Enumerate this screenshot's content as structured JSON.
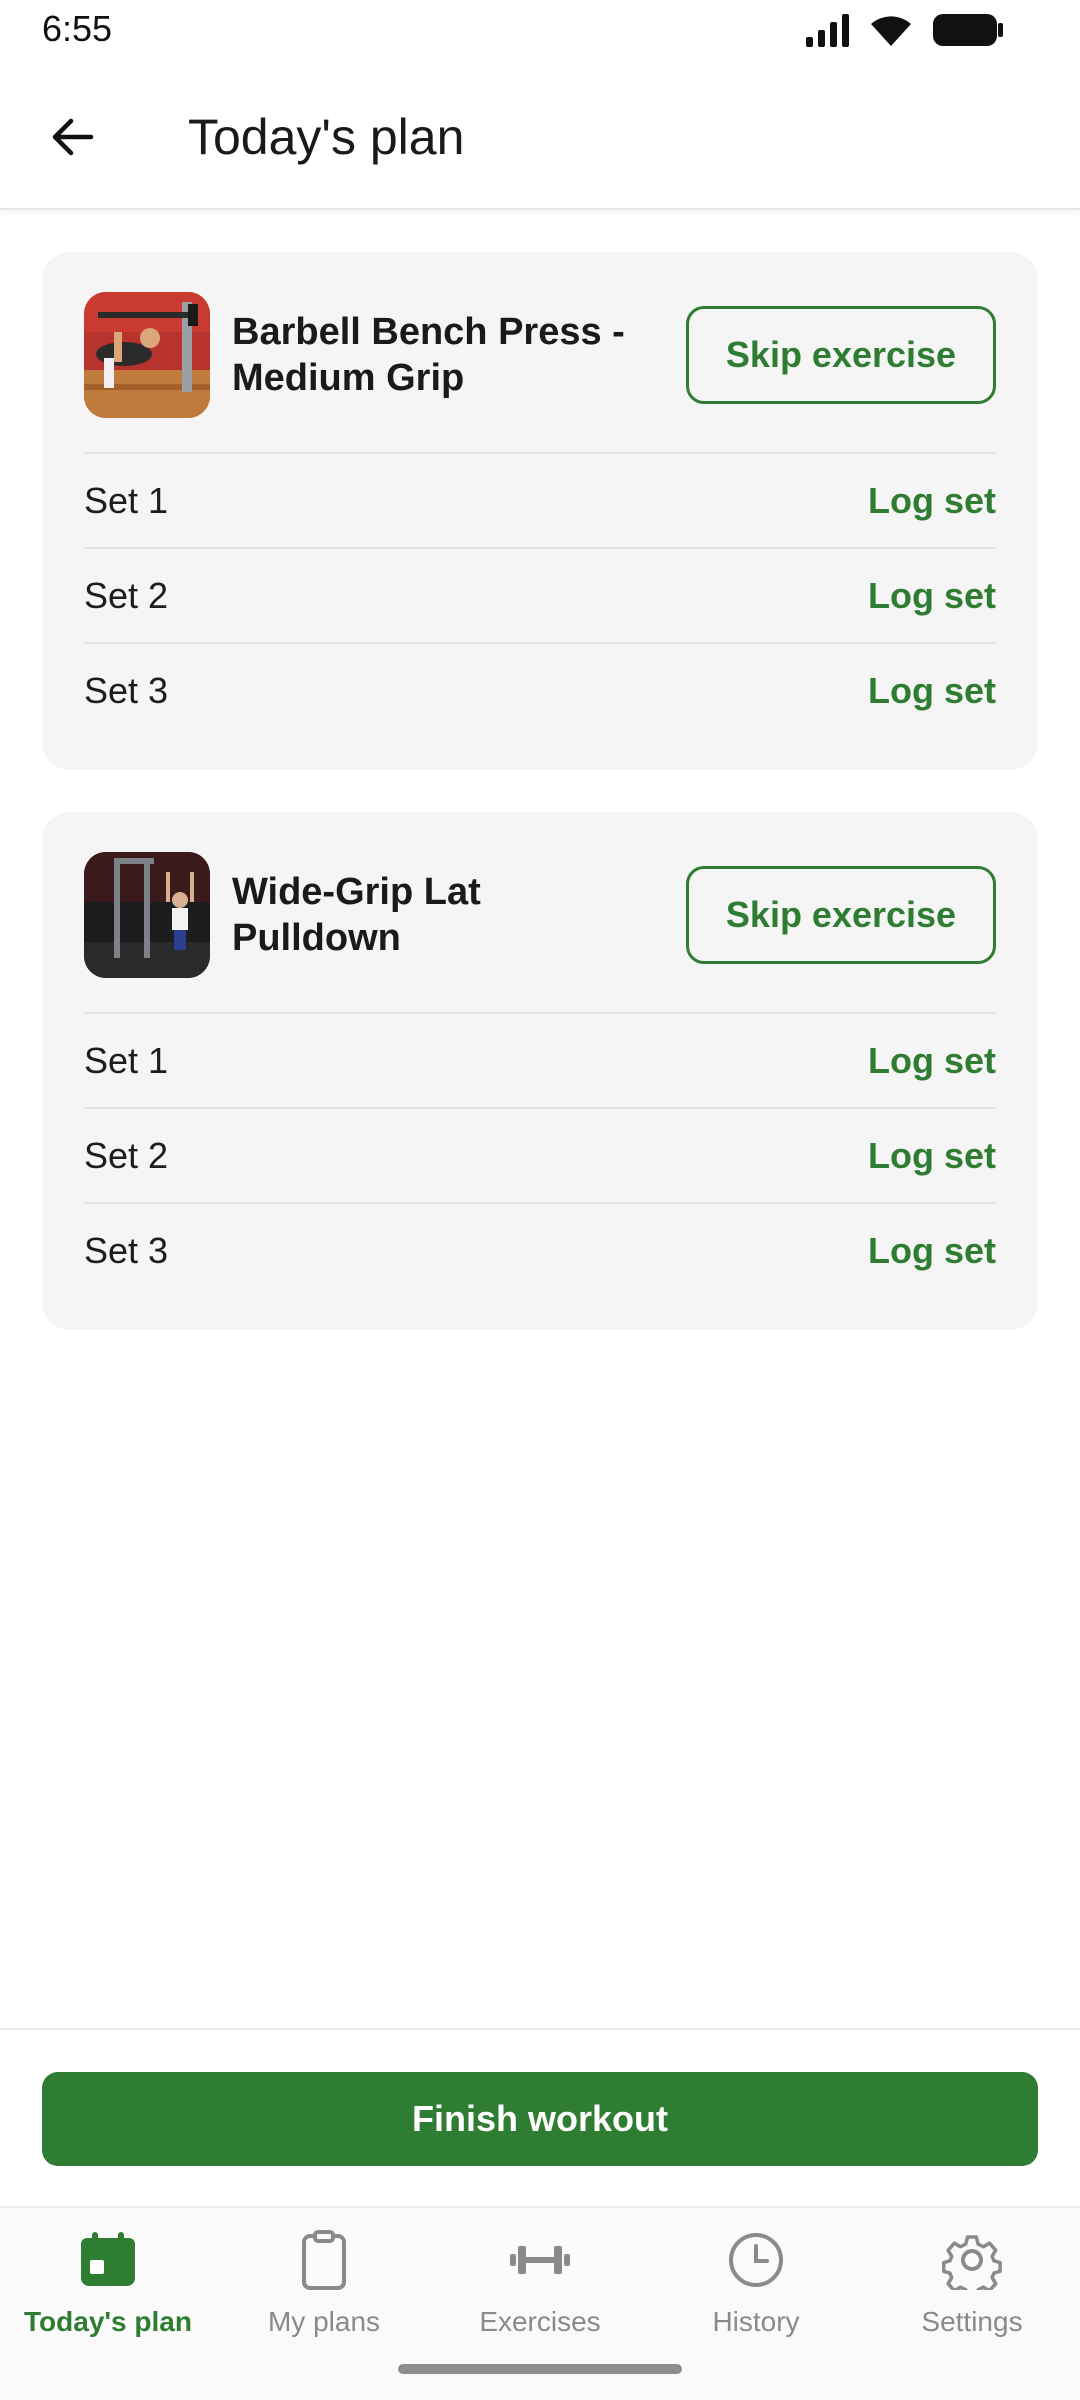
{
  "status_bar": {
    "time": "6:55"
  },
  "app_bar": {
    "title": "Today's plan"
  },
  "exercises": [
    {
      "name": "Barbell Bench Press - Medium Grip",
      "skip_label": "Skip exercise",
      "sets": [
        {
          "label": "Set 1",
          "action": "Log set"
        },
        {
          "label": "Set 2",
          "action": "Log set"
        },
        {
          "label": "Set 3",
          "action": "Log set"
        }
      ]
    },
    {
      "name": "Wide-Grip Lat Pulldown",
      "skip_label": "Skip exercise",
      "sets": [
        {
          "label": "Set 1",
          "action": "Log set"
        },
        {
          "label": "Set 2",
          "action": "Log set"
        },
        {
          "label": "Set 3",
          "action": "Log set"
        }
      ]
    }
  ],
  "finish_label": "Finish workout",
  "nav": {
    "items": [
      {
        "label": "Today's plan",
        "icon": "calendar-icon",
        "active": true
      },
      {
        "label": "My plans",
        "icon": "clipboard-icon",
        "active": false
      },
      {
        "label": "Exercises",
        "icon": "dumbbell-icon",
        "active": false
      },
      {
        "label": "History",
        "icon": "clock-icon",
        "active": false
      },
      {
        "label": "Settings",
        "icon": "gear-icon",
        "active": false
      }
    ]
  },
  "colors": {
    "accent": "#2e7d32",
    "card_bg": "#f5f5f5",
    "inactive": "#8a8a8a"
  }
}
